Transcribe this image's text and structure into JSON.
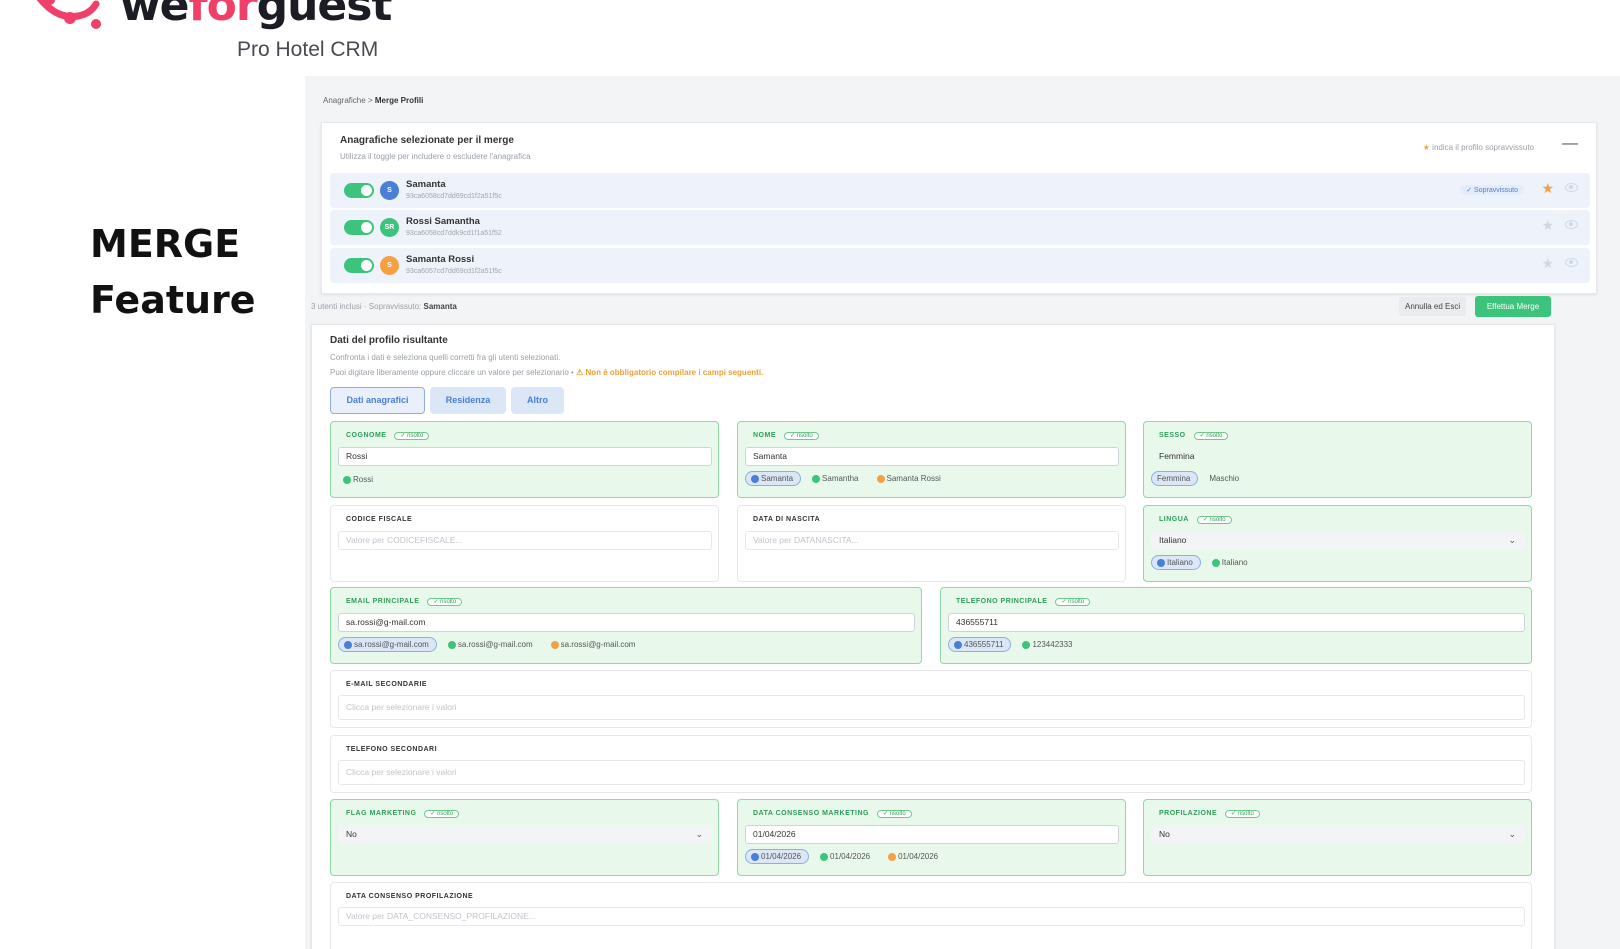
{
  "brand": {
    "name_pre": "we",
    "name_mid": "for",
    "name_post": "guest",
    "subtitle": "Pro Hotel CRM"
  },
  "feature": {
    "line1": "MERGE",
    "line2": "Feature"
  },
  "breadcrumb": {
    "parent": "Anagrafiche",
    "sep": ">",
    "current": "Merge Profili"
  },
  "selected": {
    "title": "Anagrafiche selezionate per il merge",
    "subtitle": "Utilizza il toggle per includere o escludere l'anagrafica",
    "hint_star": "★",
    "hint": "indica il profilo sopravvissuto",
    "collapse": "—",
    "rows": [
      {
        "initials": "S",
        "color": "#4a7fd6",
        "name": "Samanta",
        "id": "93ca6058cd7dd69cd1f2a51f5c",
        "badge": "✓ Sopravvissuto"
      },
      {
        "initials": "SR",
        "color": "#3cc47c",
        "name": "Rossi Samantha",
        "id": "93ca6058cd7ddk9cd1f1a51f52"
      },
      {
        "initials": "S",
        "color": "#f5a142",
        "name": "Samanta Rossi",
        "id": "93ca6057cd7dd69cd1f2a51f5c"
      }
    ]
  },
  "status": {
    "text": "3 utenti inclusi · Sopravvissuto:",
    "survivor": "Samanta",
    "cancel": "Annulla ed Esci",
    "merge": "Effettua Merge"
  },
  "result": {
    "title": "Dati del profilo risultante",
    "sub1": "Confronta i dati e seleziona quelli corretti fra gli utenti selezionati.",
    "sub2": "Puoi digitare liberamente oppure cliccare un valore per selezionario •",
    "warning": "⚠ Non è obbligatorio compilare i campi seguenti.",
    "tabs": [
      "Dati anagrafici",
      "Residenza",
      "Altro"
    ],
    "resolved": "✓ risolto",
    "fields": {
      "cognome": {
        "label": "COGNOME",
        "value": "Rossi",
        "chips": [
          "Rossi"
        ]
      },
      "nome": {
        "label": "NOME",
        "value": "Samanta",
        "chips": [
          "Samanta",
          "Samantha",
          "Samanta Rossi"
        ]
      },
      "sesso": {
        "label": "SESSO",
        "value": "Femmina",
        "chips": [
          "Femmina",
          "Maschio"
        ]
      },
      "cf": {
        "label": "CODICE FISCALE",
        "placeholder": "Valore per CODICEFISCALE..."
      },
      "nascita": {
        "label": "DATA DI NASCITA",
        "placeholder": "Valore per DATANASCITA..."
      },
      "lingua": {
        "label": "LINGUA",
        "value": "Italiano",
        "chips": [
          "Italiano",
          "Italiano"
        ]
      },
      "email": {
        "label": "EMAIL PRINCIPALE",
        "value": "sa.rossi@g-mail.com",
        "chips": [
          "sa.rossi@g-mail.com",
          "sa.rossi@g-mail.com",
          "sa.rossi@g-mail.com"
        ]
      },
      "tel": {
        "label": "TELEFONO PRINCIPALE",
        "value": "436555711",
        "chips": [
          "436555711",
          "123442333"
        ]
      },
      "email2": {
        "label": "E-MAIL SECONDARIE",
        "placeholder": "Clicca per selezionare i valori"
      },
      "tel2": {
        "label": "TELEFONO SECONDARI",
        "placeholder": "Clicca per selezionare i valori"
      },
      "flag": {
        "label": "FLAG MARKETING",
        "value": "No"
      },
      "consenso": {
        "label": "DATA CONSENSO MARKETING",
        "value": "01/04/2026",
        "chips": [
          "01/04/2026",
          "01/04/2026",
          "01/04/2026"
        ]
      },
      "profil": {
        "label": "PROFILAZIONE",
        "value": "No"
      },
      "consprof": {
        "label": "DATA CONSENSO PROFILAZIONE",
        "placeholder": "Valore per DATA_CONSENSO_PROFILAZIONE..."
      }
    }
  }
}
